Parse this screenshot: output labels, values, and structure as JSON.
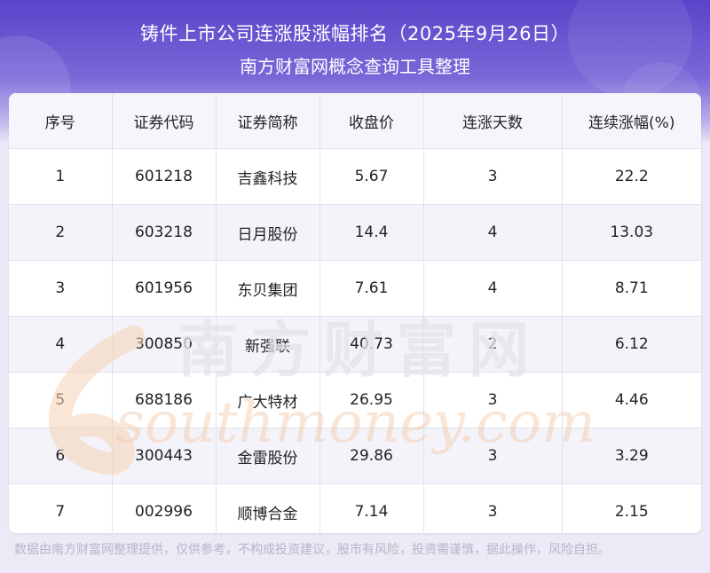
{
  "header": {
    "title": "铸件上市公司连涨股涨幅排名（2025年9月26日）",
    "subtitle": "南方财富网概念查询工具整理"
  },
  "table": {
    "columns": [
      "序号",
      "证券代码",
      "证券简称",
      "收盘价",
      "连涨天数",
      "连续涨幅(%)"
    ],
    "rows": [
      [
        "1",
        "601218",
        "吉鑫科技",
        "5.67",
        "3",
        "22.2"
      ],
      [
        "2",
        "603218",
        "日月股份",
        "14.4",
        "4",
        "13.03"
      ],
      [
        "3",
        "601956",
        "东贝集团",
        "7.61",
        "4",
        "8.71"
      ],
      [
        "4",
        "300850",
        "新强联",
        "40.73",
        "2",
        "6.12"
      ],
      [
        "5",
        "688186",
        "广大特材",
        "26.95",
        "3",
        "4.46"
      ],
      [
        "6",
        "300443",
        "金雷股份",
        "29.86",
        "3",
        "3.29"
      ],
      [
        "7",
        "002996",
        "顺博合金",
        "7.14",
        "3",
        "2.15"
      ]
    ]
  },
  "watermark": {
    "cn": "南方财富网",
    "en": "southmoney.com"
  },
  "footer": {
    "disclaimer": "数据由南方财富网整理提供，仅供参考，不构成投资建议，股市有风险，投资需谨慎，据此操作，风险自担。"
  },
  "colors": {
    "header_top": "#5a44c9",
    "header_mid": "#7a68d8",
    "row_alt": "#f4f3fa",
    "watermark": "#f3c9a8"
  }
}
